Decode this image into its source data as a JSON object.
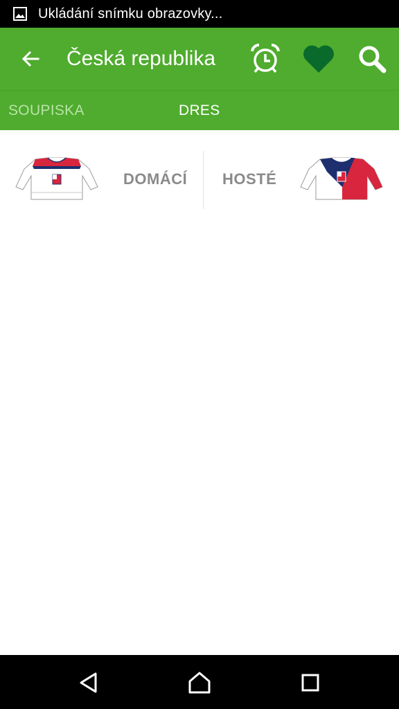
{
  "status_bar": {
    "notification_text": "Ukládání snímku obrazovky..."
  },
  "toolbar": {
    "title": "Česká republika",
    "colors": {
      "background": "#4fac2e",
      "favorite": "#0a6a2c"
    },
    "icons": [
      "back-arrow-icon",
      "alarm-clock-icon",
      "heart-icon",
      "search-icon"
    ]
  },
  "tabs": [
    {
      "label": "SOUPISKA",
      "selected": false
    },
    {
      "label": "DRES",
      "selected": true
    }
  ],
  "jerseys": {
    "home": {
      "label": "DOMÁCÍ",
      "colors": [
        "#ffffff",
        "#d7263d",
        "#1d2f6f"
      ]
    },
    "away": {
      "label": "HOSTÉ",
      "colors": [
        "#1d2f6f",
        "#d7263d",
        "#ffffff"
      ]
    }
  },
  "navbar": {
    "icons": [
      "back-triangle-icon",
      "home-icon",
      "recents-icon"
    ]
  }
}
